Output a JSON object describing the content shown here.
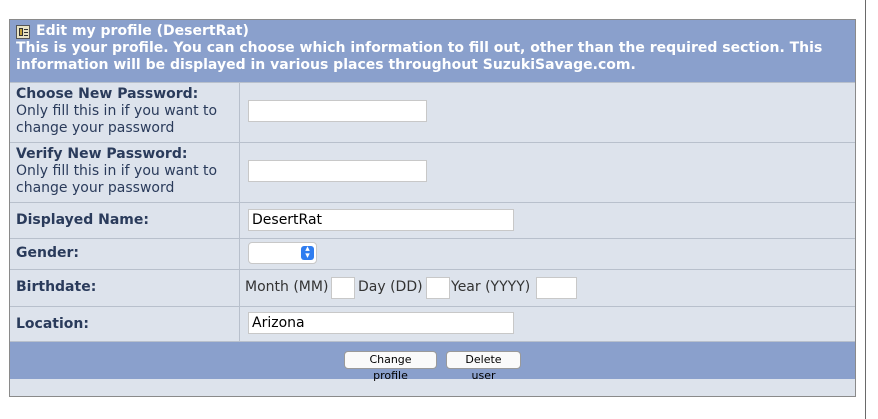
{
  "header": {
    "title": "Edit my profile (DesertRat)",
    "description": "This is your profile. You can choose which information to fill out, other than the required section. This information will be displayed in various places throughout SuzukiSavage.com."
  },
  "fields": {
    "new_password": {
      "label": "Choose New Password:",
      "hint": "Only fill this in if you want to change your password",
      "value": ""
    },
    "verify_password": {
      "label": "Verify New Password:",
      "hint": "Only fill this in if you want to change your password",
      "value": ""
    },
    "displayed_name": {
      "label": "Displayed Name:",
      "value": "DesertRat"
    },
    "gender": {
      "label": "Gender:",
      "value": ""
    },
    "birthdate": {
      "label": "Birthdate:",
      "month_label": "Month (MM)",
      "day_label": "Day (DD)",
      "year_label": "Year (YYYY)",
      "month": "",
      "day": "",
      "year": ""
    },
    "location": {
      "label": "Location:",
      "value": "Arizona"
    }
  },
  "buttons": {
    "change_profile": "Change profile",
    "delete_user": "Delete user"
  },
  "icons": {
    "profile_icon": "profile-book-icon",
    "select_arrow": "up-down-chevron-icon"
  },
  "colors": {
    "header_bg": "#8aa0cc",
    "row_bg": "#dde3ec",
    "label_text": "#2a3b5b"
  }
}
